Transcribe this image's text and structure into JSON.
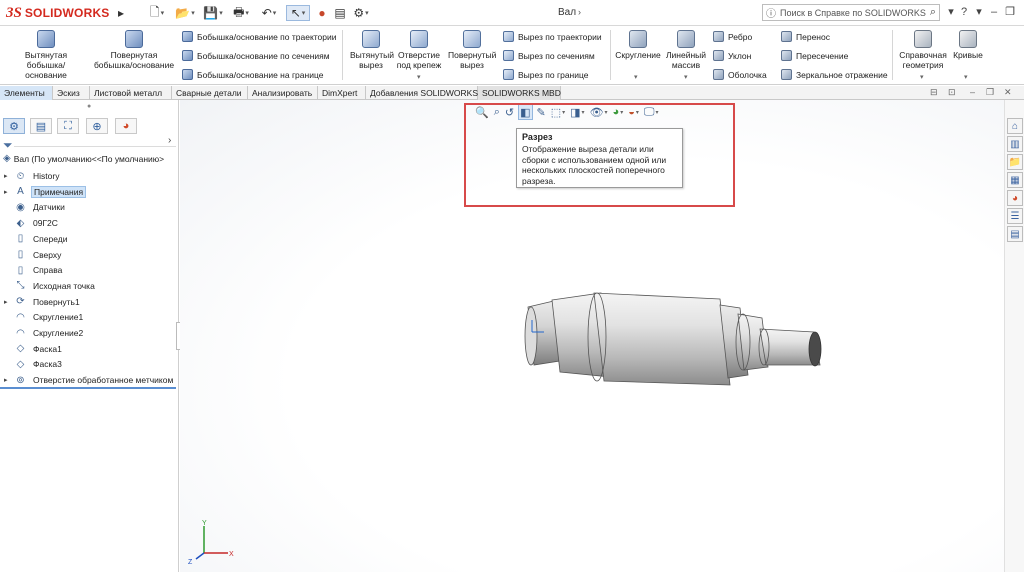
{
  "app": {
    "logo_mark": "3S",
    "logo_name": "SOLIDWORKS",
    "document_title": "Вал"
  },
  "help": {
    "search_placeholder": "Поиск в Справке по SOLIDWORKS"
  },
  "ribbon": {
    "extruded_boss": "Вытянутая бобышка/основание",
    "revolved_boss": "Повернутая бобышка/основание",
    "swept_boss": "Бобышка/основание по траектории",
    "lofted_boss": "Бобышка/основание по сечениям",
    "boundary_boss": "Бобышка/основание на границе",
    "extruded_cut": "Вытянутый вырез",
    "hole_wizard": "Отверстие под крепеж",
    "revolved_cut": "Повернутый вырез",
    "swept_cut": "Вырез по траектории",
    "lofted_cut": "Вырез по сечениям",
    "boundary_cut": "Вырез по границе",
    "fillet": "Скругление",
    "linear_pattern": "Линейный массив",
    "rib": "Ребро",
    "draft": "Уклон",
    "shell": "Оболочка",
    "wrap": "Перенос",
    "intersect": "Пересечение",
    "mirror": "Зеркальное отражение",
    "reference_geometry": "Справочная геометрия",
    "curves": "Кривые"
  },
  "tabs": [
    "Элементы",
    "Эскиз",
    "Листовой металл",
    "Сварные детали",
    "Анализировать",
    "DimXpert",
    "Добавления SOLIDWORKS",
    "SOLIDWORKS MBD"
  ],
  "tree": {
    "root": "Вал  (По умолчанию<<По умолчанию>",
    "items": [
      {
        "label": "History",
        "icon": "history-icon",
        "expandable": true
      },
      {
        "label": "Примечания",
        "icon": "annotations-icon",
        "expandable": true,
        "selected": true
      },
      {
        "label": "Датчики",
        "icon": "sensors-icon",
        "expandable": false
      },
      {
        "label": "09Г2С",
        "icon": "material-icon",
        "expandable": false
      },
      {
        "label": "Спереди",
        "icon": "plane-icon",
        "expandable": false
      },
      {
        "label": "Сверху",
        "icon": "plane-icon",
        "expandable": false
      },
      {
        "label": "Справа",
        "icon": "plane-icon",
        "expandable": false
      },
      {
        "label": "Исходная точка",
        "icon": "origin-icon",
        "expandable": false
      },
      {
        "label": "Повернуть1",
        "icon": "revolve-icon",
        "expandable": true
      },
      {
        "label": "Скругление1",
        "icon": "fillet-icon",
        "expandable": false
      },
      {
        "label": "Скругление2",
        "icon": "fillet-icon",
        "expandable": false
      },
      {
        "label": "Фаска1",
        "icon": "chamfer-icon",
        "expandable": false
      },
      {
        "label": "Фаска3",
        "icon": "chamfer-icon",
        "expandable": false
      },
      {
        "label": "Отверстие обработанное метчиком",
        "icon": "tapped-hole-icon",
        "expandable": true
      }
    ]
  },
  "tooltip": {
    "title": "Разрез",
    "body": "Отображение выреза детали или сборки с использованием одной или нескольких плоскостей поперечного разреза."
  },
  "triad": {
    "x": "X",
    "y": "Y",
    "z": "Z"
  },
  "colors": {
    "brand": "#d42a1f",
    "highlight": "#d74a4a",
    "selection": "#cfe3f8"
  }
}
